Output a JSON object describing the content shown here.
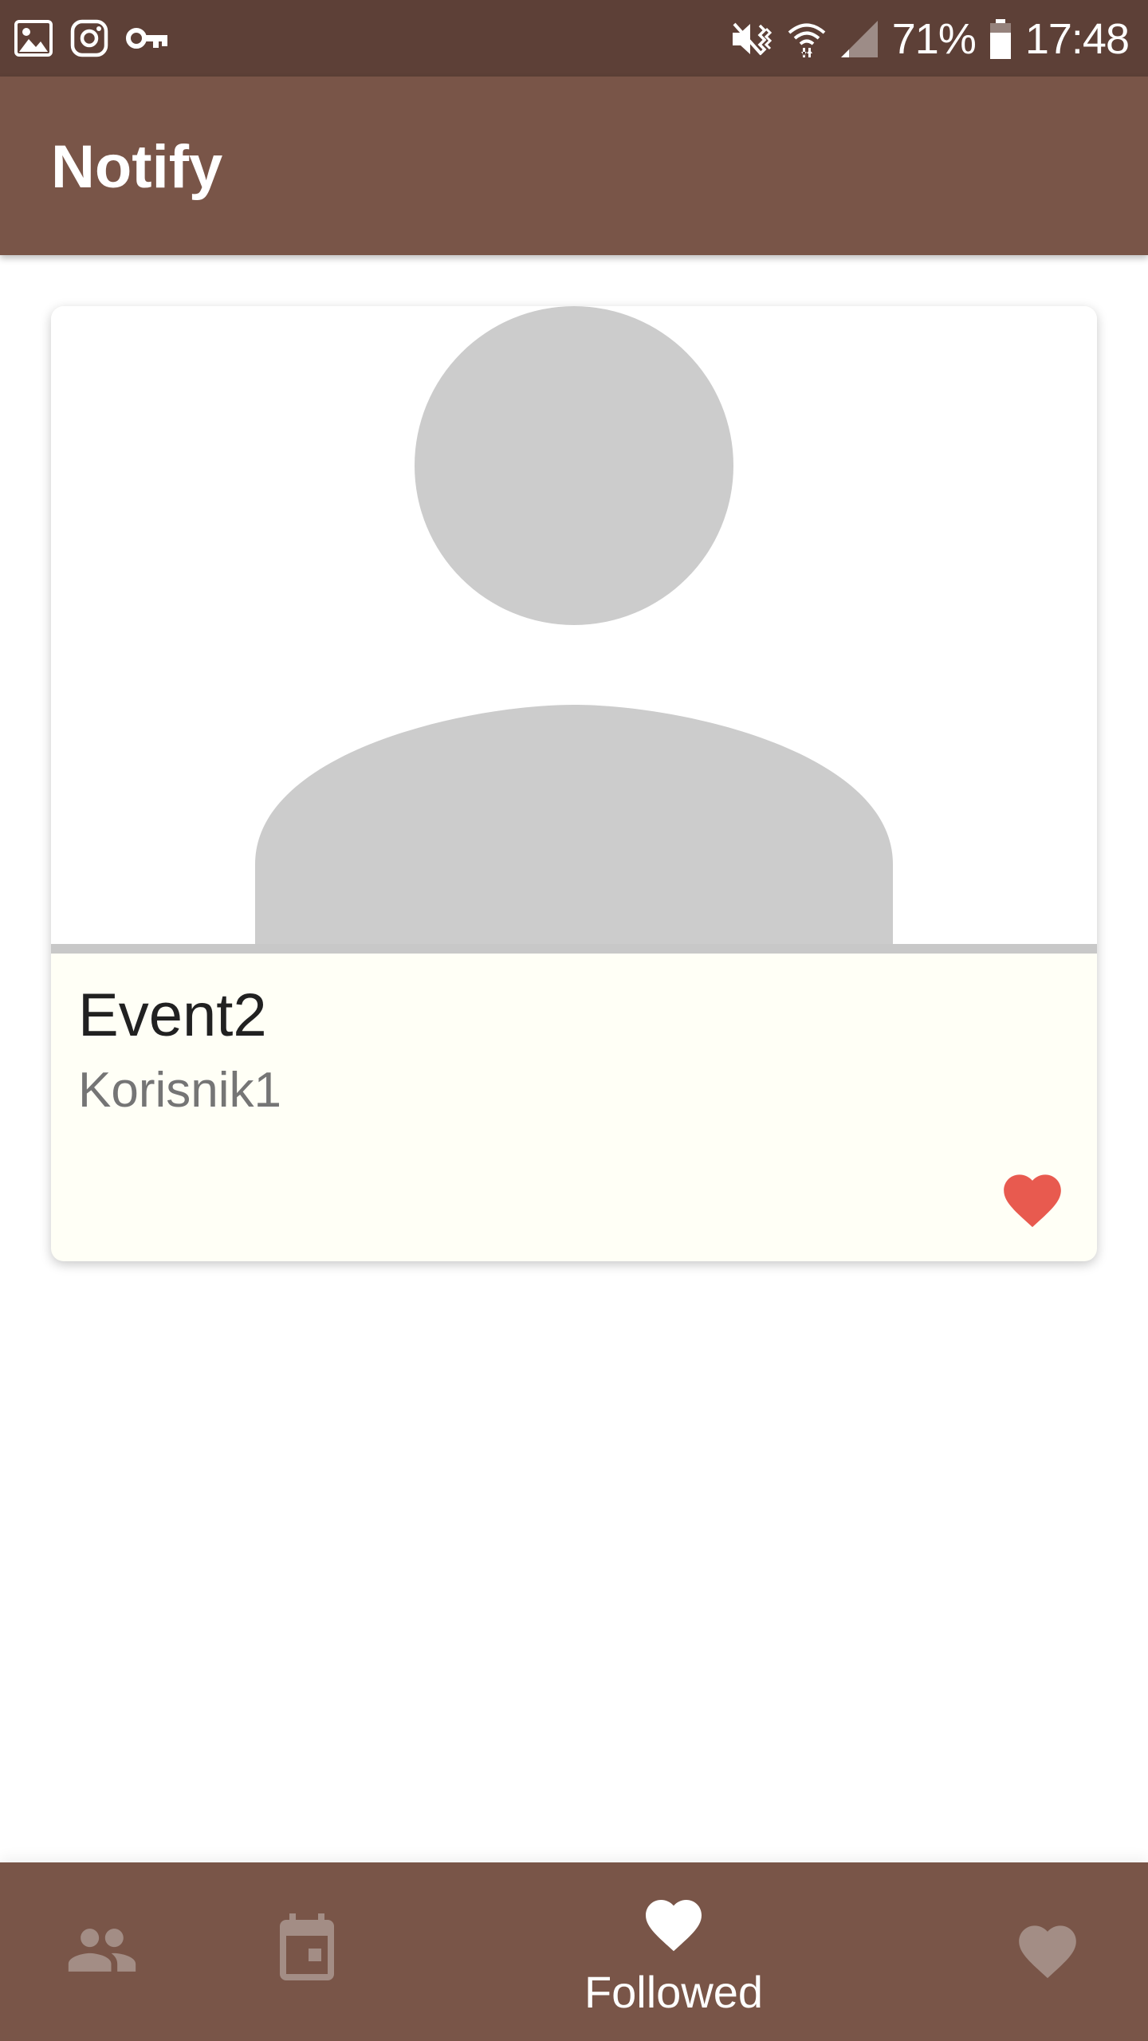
{
  "status_bar": {
    "left_icons": [
      "image-icon",
      "instagram-icon",
      "vpn-key-icon"
    ],
    "right_icons": [
      "mute-vibrate-icon",
      "wifi-icon",
      "signal-icon",
      "battery-icon"
    ],
    "battery_percent": "71%",
    "time": "17:48"
  },
  "app_bar": {
    "title": "Notify"
  },
  "event_card": {
    "image_icon": "person-placeholder-icon",
    "title": "Event2",
    "subtitle": "Korisnik1",
    "favorite_icon": "heart-icon",
    "favorite_color": "#e85a4f",
    "favorited": true
  },
  "bottom_nav": {
    "items": [
      {
        "id": "people",
        "icon": "people-icon",
        "label": "",
        "active": false
      },
      {
        "id": "events",
        "icon": "calendar-icon",
        "label": "",
        "active": false
      },
      {
        "id": "followed",
        "icon": "heart-icon",
        "label": "Followed",
        "active": true
      },
      {
        "id": "favorites",
        "icon": "heart-icon",
        "label": "",
        "active": false
      }
    ]
  },
  "colors": {
    "status_bar": "#5d4037",
    "primary": "#795548",
    "card_background": "#fffff6",
    "placeholder": "#cccccc",
    "inactive_icon": "#a38d85"
  }
}
